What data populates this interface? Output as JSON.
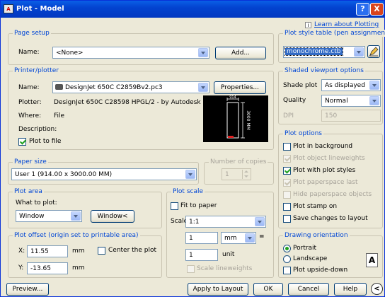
{
  "window": {
    "title": "Plot - Model",
    "help_label": "?",
    "close_label": "X"
  },
  "learn_link": "Learn about Plotting",
  "page_setup": {
    "legend": "Page setup",
    "name_label": "Name:",
    "name_value": "<None>",
    "add_button": "Add..."
  },
  "printer": {
    "legend": "Printer/plotter",
    "name_label": "Name:",
    "name_value": "DesignJet 650C C2859Bv2.pc3",
    "properties_button": "Properties...",
    "plotter_label": "Plotter:",
    "plotter_value": "DesignJet 650C C28598 HPGL/2 - by Autodesk",
    "where_label": "Where:",
    "where_value": "File",
    "description_label": "Description:",
    "plot_to_file": "Plot to file",
    "preview_width": "914",
    "preview_height": "3000 MM"
  },
  "paper_size": {
    "legend": "Paper size",
    "value": "User 1 (914.00 x 3000.00 MM)"
  },
  "copies": {
    "legend": "Number of copies",
    "value": "1"
  },
  "plot_area": {
    "legend": "Plot area",
    "what_label": "What to plot:",
    "what_value": "Window",
    "window_button": "Window<"
  },
  "plot_offset": {
    "legend": "Plot offset (origin set to printable area)",
    "x_label": "X:",
    "x_value": "11.55",
    "x_unit": "mm",
    "y_label": "Y:",
    "y_value": "-13.65",
    "y_unit": "mm",
    "center_label": "Center the plot"
  },
  "plot_scale": {
    "legend": "Plot scale",
    "fit_label": "Fit to paper",
    "scale_label": "Scale:",
    "scale_value": "1:1",
    "num1": "1",
    "unit1": "mm",
    "equals": "=",
    "num2": "1",
    "unit2": "unit",
    "lineweights_label": "Scale lineweights"
  },
  "style_table": {
    "legend": "Plot style table (pen assignments)",
    "value": "monochrome.ctb"
  },
  "shaded": {
    "legend": "Shaded viewport options",
    "shade_label": "Shade plot",
    "shade_value": "As displayed",
    "quality_label": "Quality",
    "quality_value": "Normal",
    "dpi_label": "DPI",
    "dpi_value": "150"
  },
  "plot_options": {
    "legend": "Plot options",
    "items": [
      {
        "label": "Plot in background",
        "checked": false,
        "disabled": false
      },
      {
        "label": "Plot object lineweights",
        "checked": true,
        "disabled": true
      },
      {
        "label": "Plot with plot styles",
        "checked": true,
        "disabled": false
      },
      {
        "label": "Plot paperspace last",
        "checked": true,
        "disabled": true
      },
      {
        "label": "Hide paperspace objects",
        "checked": false,
        "disabled": true
      },
      {
        "label": "Plot stamp on",
        "checked": false,
        "disabled": false
      },
      {
        "label": "Save changes to layout",
        "checked": false,
        "disabled": false
      }
    ]
  },
  "orientation": {
    "legend": "Drawing orientation",
    "portrait": "Portrait",
    "landscape": "Landscape",
    "upside_down": "Plot upside-down",
    "icon_letter": "A"
  },
  "bottom": {
    "preview": "Preview...",
    "apply": "Apply to Layout",
    "ok": "OK",
    "cancel": "Cancel",
    "help": "Help",
    "collapse": "<"
  }
}
